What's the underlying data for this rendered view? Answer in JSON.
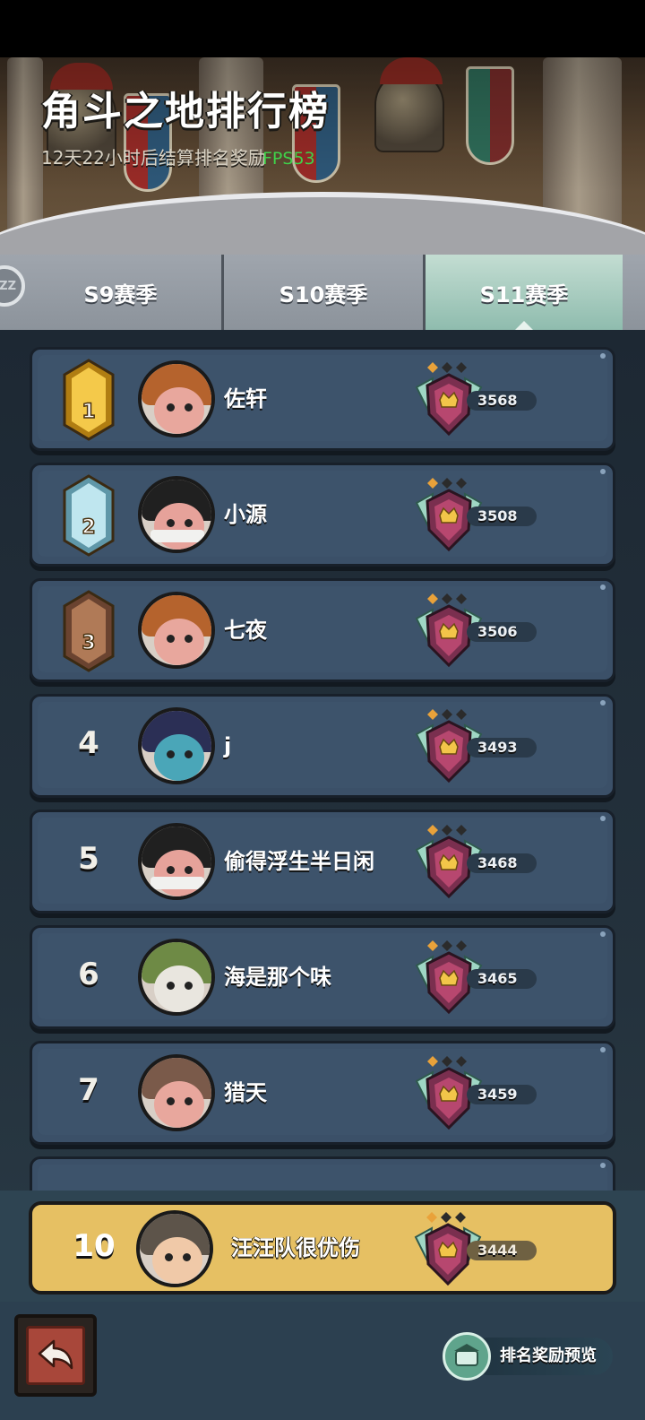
{
  "header": {
    "title": "角斗之地排行榜",
    "countdown": "12天22小时后结算排名奖励",
    "fps_overlay": "FPS53",
    "zz_badge": "ZZ"
  },
  "tabs": [
    {
      "label": "S9赛季",
      "active": false
    },
    {
      "label": "S10赛季",
      "active": false
    },
    {
      "label": "S11赛季",
      "active": true
    }
  ],
  "leaderboard": [
    {
      "rank": "1",
      "medal": "gold",
      "name": "佐轩",
      "score": "3568",
      "avatar": "pumpkin"
    },
    {
      "rank": "2",
      "medal": "silver",
      "name": "小源",
      "score": "3508",
      "avatar": "masked"
    },
    {
      "rank": "3",
      "medal": "bronze",
      "name": "七夜",
      "score": "3506",
      "avatar": "pumpkin"
    },
    {
      "rank": "4",
      "medal": "none",
      "name": "j",
      "score": "3493",
      "avatar": "blue"
    },
    {
      "rank": "5",
      "medal": "none",
      "name": "偷得浮生半日闲",
      "score": "3468",
      "avatar": "masked"
    },
    {
      "rank": "6",
      "medal": "none",
      "name": "海是那个味",
      "score": "3465",
      "avatar": "raccoon"
    },
    {
      "rank": "7",
      "medal": "none",
      "name": "猎天",
      "score": "3459",
      "avatar": "hood"
    }
  ],
  "my_rank": {
    "rank": "10",
    "name": "汪汪队很优伤",
    "score": "3444"
  },
  "footer": {
    "reward_preview_label": "排名奖励预览"
  },
  "colors": {
    "row_bg": "#3b5068",
    "my_row_bg": "#e6c063",
    "active_tab": "#a6cdbf",
    "gold": "#e9b537",
    "silver": "#9fd0de",
    "bronze": "#9a6748"
  }
}
